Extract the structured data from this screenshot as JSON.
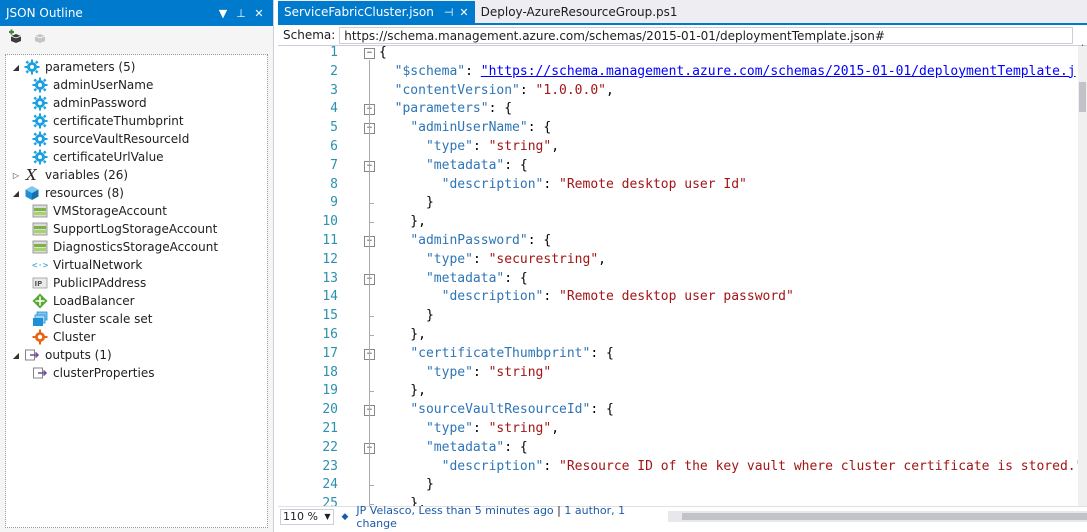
{
  "outline": {
    "title": "JSON Outline",
    "tree": [
      {
        "label": "parameters (5)",
        "level": 0,
        "icon": "gear-icon",
        "expanded": true
      },
      {
        "label": "adminUserName",
        "level": 1,
        "icon": "gear-icon"
      },
      {
        "label": "adminPassword",
        "level": 1,
        "icon": "gear-icon"
      },
      {
        "label": "certificateThumbprint",
        "level": 1,
        "icon": "gear-icon"
      },
      {
        "label": "sourceVaultResourceId",
        "level": 1,
        "icon": "gear-icon"
      },
      {
        "label": "certificateUrlValue",
        "level": 1,
        "icon": "gear-icon"
      },
      {
        "label": "variables (26)",
        "level": 0,
        "icon": "variable-icon",
        "expanded": false
      },
      {
        "label": "resources (8)",
        "level": 0,
        "icon": "cube-icon",
        "expanded": true
      },
      {
        "label": "VMStorageAccount",
        "level": 1,
        "icon": "storage-icon"
      },
      {
        "label": "SupportLogStorageAccount",
        "level": 1,
        "icon": "storage-icon"
      },
      {
        "label": "DiagnosticsStorageAccount",
        "level": 1,
        "icon": "storage-icon"
      },
      {
        "label": "VirtualNetwork",
        "level": 1,
        "icon": "network-icon"
      },
      {
        "label": "PublicIPAddress",
        "level": 1,
        "icon": "ip-icon"
      },
      {
        "label": "LoadBalancer",
        "level": 1,
        "icon": "loadbalancer-icon"
      },
      {
        "label": "Cluster scale set",
        "level": 1,
        "icon": "scaleset-icon"
      },
      {
        "label": "Cluster",
        "level": 1,
        "icon": "cluster-icon"
      },
      {
        "label": "outputs (1)",
        "level": 0,
        "icon": "output-icon",
        "expanded": true
      },
      {
        "label": "clusterProperties",
        "level": 1,
        "icon": "output-icon"
      }
    ]
  },
  "tabs": [
    {
      "label": "ServiceFabricCluster.json",
      "active": true
    },
    {
      "label": "Deploy-AzureResourceGroup.ps1",
      "active": false
    }
  ],
  "schema": {
    "label": "Schema:",
    "value": "https://schema.management.azure.com/schemas/2015-01-01/deploymentTemplate.json#"
  },
  "editor": {
    "lines": [
      [
        [
          "p",
          "{"
        ]
      ],
      [
        [
          "p",
          "  "
        ],
        [
          "k",
          "\"$schema\""
        ],
        [
          "p",
          ": "
        ],
        [
          "u",
          "\"https://schema.management.azure.com/schemas/2015-01-01/deploymentTemplate.j"
        ]
      ],
      [
        [
          "p",
          "  "
        ],
        [
          "k",
          "\"contentVersion\""
        ],
        [
          "p",
          ": "
        ],
        [
          "s",
          "\"1.0.0.0\""
        ],
        [
          "p",
          ","
        ]
      ],
      [
        [
          "p",
          "  "
        ],
        [
          "k",
          "\"parameters\""
        ],
        [
          "p",
          ": {"
        ]
      ],
      [
        [
          "p",
          "    "
        ],
        [
          "k",
          "\"adminUserName\""
        ],
        [
          "p",
          ": {"
        ]
      ],
      [
        [
          "p",
          "      "
        ],
        [
          "k",
          "\"type\""
        ],
        [
          "p",
          ": "
        ],
        [
          "s",
          "\"string\""
        ],
        [
          "p",
          ","
        ]
      ],
      [
        [
          "p",
          "      "
        ],
        [
          "k",
          "\"metadata\""
        ],
        [
          "p",
          ": {"
        ]
      ],
      [
        [
          "p",
          "        "
        ],
        [
          "k",
          "\"description\""
        ],
        [
          "p",
          ": "
        ],
        [
          "s",
          "\"Remote desktop user Id\""
        ]
      ],
      [
        [
          "p",
          "      }"
        ]
      ],
      [
        [
          "p",
          "    },"
        ]
      ],
      [
        [
          "p",
          "    "
        ],
        [
          "k",
          "\"adminPassword\""
        ],
        [
          "p",
          ": {"
        ]
      ],
      [
        [
          "p",
          "      "
        ],
        [
          "k",
          "\"type\""
        ],
        [
          "p",
          ": "
        ],
        [
          "s",
          "\"securestring\""
        ],
        [
          "p",
          ","
        ]
      ],
      [
        [
          "p",
          "      "
        ],
        [
          "k",
          "\"metadata\""
        ],
        [
          "p",
          ": {"
        ]
      ],
      [
        [
          "p",
          "        "
        ],
        [
          "k",
          "\"description\""
        ],
        [
          "p",
          ": "
        ],
        [
          "s",
          "\"Remote desktop user password\""
        ]
      ],
      [
        [
          "p",
          "      }"
        ]
      ],
      [
        [
          "p",
          "    },"
        ]
      ],
      [
        [
          "p",
          "    "
        ],
        [
          "k",
          "\"certificateThumbprint\""
        ],
        [
          "p",
          ": {"
        ]
      ],
      [
        [
          "p",
          "      "
        ],
        [
          "k",
          "\"type\""
        ],
        [
          "p",
          ": "
        ],
        [
          "s",
          "\"string\""
        ]
      ],
      [
        [
          "p",
          "    },"
        ]
      ],
      [
        [
          "p",
          "    "
        ],
        [
          "k",
          "\"sourceVaultResourceId\""
        ],
        [
          "p",
          ": {"
        ]
      ],
      [
        [
          "p",
          "      "
        ],
        [
          "k",
          "\"type\""
        ],
        [
          "p",
          ": "
        ],
        [
          "s",
          "\"string\""
        ],
        [
          "p",
          ","
        ]
      ],
      [
        [
          "p",
          "      "
        ],
        [
          "k",
          "\"metadata\""
        ],
        [
          "p",
          ": {"
        ]
      ],
      [
        [
          "p",
          "        "
        ],
        [
          "k",
          "\"description\""
        ],
        [
          "p",
          ": "
        ],
        [
          "s",
          "\"Resource ID of the key vault where cluster certificate is stored.\""
        ]
      ],
      [
        [
          "p",
          "      }"
        ]
      ],
      [
        [
          "p",
          "    },"
        ]
      ]
    ],
    "folds": [
      1,
      4,
      5,
      7,
      11,
      13,
      17,
      20,
      22
    ]
  },
  "status": {
    "zoom": "110 %",
    "author_info": "JP Velasco, Less than 5 minutes ago",
    "separator": "|",
    "change_info": "1 author, 1 change"
  }
}
